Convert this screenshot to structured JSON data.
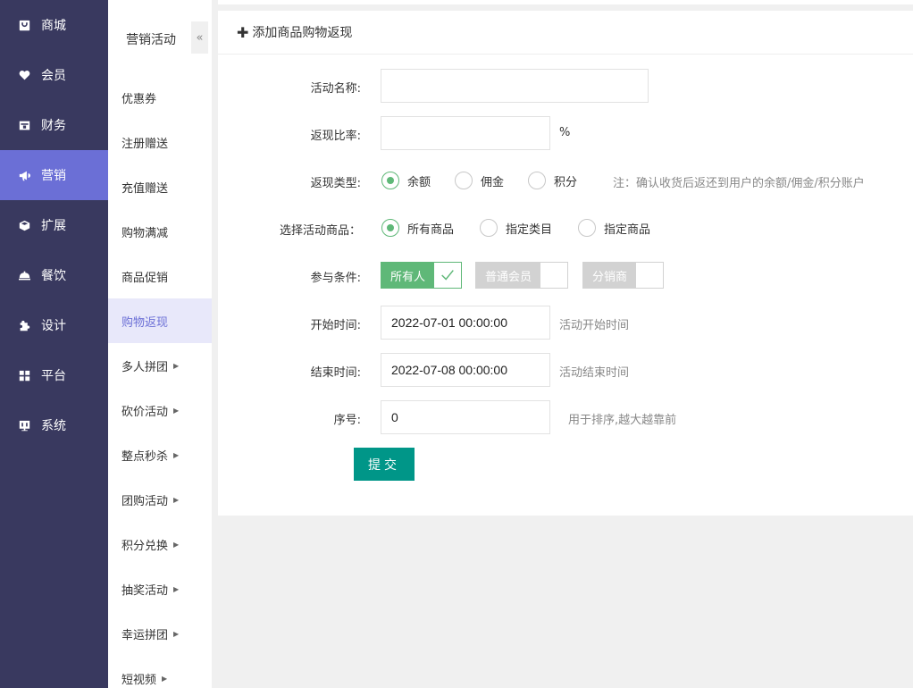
{
  "nav1": [
    {
      "label": "商城",
      "icon": "store-icon",
      "active": false
    },
    {
      "label": "会员",
      "icon": "heart-icon",
      "active": false
    },
    {
      "label": "财务",
      "icon": "wallet-icon",
      "active": false
    },
    {
      "label": "营销",
      "icon": "megaphone-icon",
      "active": true
    },
    {
      "label": "扩展",
      "icon": "cube-icon",
      "active": false
    },
    {
      "label": "餐饮",
      "icon": "cloche-icon",
      "active": false
    },
    {
      "label": "设计",
      "icon": "puzzle-icon",
      "active": false
    },
    {
      "label": "平台",
      "icon": "grid-icon",
      "active": false
    },
    {
      "label": "系统",
      "icon": "monitor-icon",
      "active": false
    }
  ],
  "nav2": {
    "title": "营销活动",
    "collapse": "«",
    "items": [
      {
        "label": "优惠券",
        "arrow": ""
      },
      {
        "label": "注册赠送",
        "arrow": ""
      },
      {
        "label": "充值赠送",
        "arrow": ""
      },
      {
        "label": "购物满减",
        "arrow": ""
      },
      {
        "label": "商品促销",
        "arrow": ""
      },
      {
        "label": "购物返现",
        "arrow": ""
      },
      {
        "label": "多人拼团",
        "arrow": "▶"
      },
      {
        "label": "砍价活动",
        "arrow": "▶"
      },
      {
        "label": "整点秒杀",
        "arrow": "▶"
      },
      {
        "label": "团购活动",
        "arrow": "▶"
      },
      {
        "label": "积分兑换",
        "arrow": "▶"
      },
      {
        "label": "抽奖活动",
        "arrow": "▶"
      },
      {
        "label": "幸运拼团",
        "arrow": "▶"
      },
      {
        "label": "短视频",
        "arrow": "▶"
      }
    ]
  },
  "header": {
    "plus": "✚",
    "title": "添加商品购物返现"
  },
  "form": {
    "name_label": "活动名称:",
    "name_value": "",
    "rate_label": "返现比率:",
    "rate_value": "",
    "rate_unit": "%",
    "type_label": "返现类型:",
    "type_options": [
      "余额",
      "佣金",
      "积分"
    ],
    "type_selected": "余额",
    "type_note": "注：确认收货后返还到用户的余额/佣金/积分账户",
    "goods_label": "选择活动商品：",
    "goods_options": [
      "所有商品",
      "指定类目",
      "指定商品"
    ],
    "goods_selected": "所有商品",
    "cond_label": "参与条件:",
    "cond_options": [
      {
        "label": "所有人",
        "checked": true
      },
      {
        "label": "普通会员",
        "checked": false
      },
      {
        "label": "分销商",
        "checked": false
      }
    ],
    "start_label": "开始时间:",
    "start_value": "2022-07-01 00:00:00",
    "start_hint": "活动开始时间",
    "end_label": "结束时间:",
    "end_value": "2022-07-08 00:00:00",
    "end_hint": "活动结束时间",
    "sort_label": "序号:",
    "sort_value": "0",
    "sort_hint": "用于排序,越大越靠前",
    "submit_label": "提交"
  },
  "colors": {
    "nav_bg": "#39395f",
    "nav_active": "#6b6fd6",
    "green": "#5fb878",
    "teal": "#009688"
  }
}
